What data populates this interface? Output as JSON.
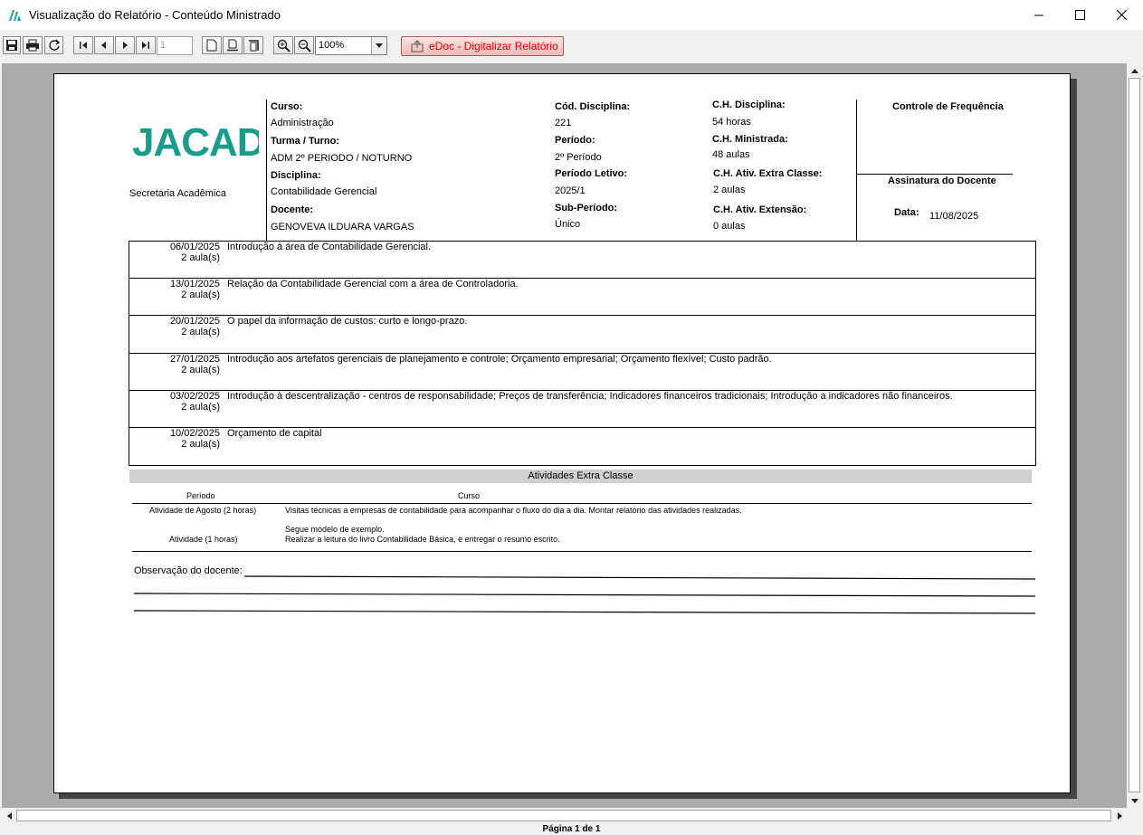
{
  "window": {
    "title": "Visualização do Relatório - Conteúdo Ministrado",
    "logo_icon": "jacad-logo-icon",
    "controls": [
      "minimize-icon",
      "maximize-icon",
      "close-icon"
    ]
  },
  "toolbar": {
    "page_value": "1",
    "zoom_value": "100%",
    "edoc_label": "eDoc - Digitalizar Relatório",
    "icons": [
      "save-icon",
      "print-icon",
      "refresh-icon",
      "first-page-icon",
      "prev-page-icon",
      "next-page-icon",
      "last-page-icon",
      "single-page-icon",
      "page-width-icon",
      "full-page-icon",
      "zoom-in-icon",
      "zoom-out-icon",
      "edoc-upload-icon"
    ]
  },
  "report": {
    "logo_text": "JACAD",
    "secretaria": "Secretaria Acadêmica",
    "curso_label": "Curso:",
    "curso": "Administração",
    "turma_label": "Turma / Turno:",
    "turma": "ADM 2º PERIODO / NOTURNO",
    "disciplina_label": "Disciplina:",
    "disciplina": "Contabilidade Gerencial",
    "docente_label": "Docente:",
    "docente": "GENOVEVA ILDUARA VARGAS",
    "cod_label": "Cód. Disciplina:",
    "cod": "221",
    "periodo_label": "Período:",
    "periodo": "2º Período",
    "periodo_letivo_label": "Período Letivo:",
    "periodo_letivo": "2025/1",
    "sub_periodo_label": "Sub-Período:",
    "sub_periodo": "Único",
    "ch_disciplina_label": "C.H. Disciplina:",
    "ch_disciplina": "54 horas",
    "ch_ministrada_label": "C.H. Ministrada:",
    "ch_ministrada": "48 aulas",
    "ch_extra_label": "C.H. Ativ. Extra Classe:",
    "ch_extra": "2 aulas",
    "ch_extensao_label": "C.H. Ativ. Extensão:",
    "ch_extensao": "0 aulas",
    "controle_label": "Controle de Frequência",
    "assinatura_label": "Assinatura do Docente",
    "data_label": "Data:",
    "data": "11/08/2025",
    "aulas": [
      {
        "date": "06/01/2025",
        "count": "2 aula(s)",
        "topic": "Introdução à área de Contabilidade Gerencial."
      },
      {
        "date": "13/01/2025",
        "count": "2 aula(s)",
        "topic": "Relação da Contabilidade Gerencial com a área de Controladoria."
      },
      {
        "date": "20/01/2025",
        "count": "2 aula(s)",
        "topic": "O papel da informação de custos: curto e longo-prazo."
      },
      {
        "date": "27/01/2025",
        "count": "2 aula(s)",
        "topic": "Introdução aos artefatos gerenciais de planejamento e controle; Orçamento empresarial; Orçamento flexível; Custo padrão."
      },
      {
        "date": "03/02/2025",
        "count": "2 aula(s)",
        "topic": "Introdução à descentralização - centros de responsabilidade; Preços de transferência; Indicadores financeiros tradicionais; Introdução a indicadores não financeiros."
      },
      {
        "date": "10/02/2025",
        "count": "2 aula(s)",
        "topic": "Orçamento de capital"
      }
    ],
    "extra_title": "Atividades Extra Classe",
    "extra_header_periodo": "Período",
    "extra_header_curso": "Curso",
    "extra_rows": [
      {
        "periodo": "Atividade de Agosto (2 horas)",
        "curso": "Visitas técnicas a empresas de contabilidade para acompanhar o fluxo do dia a dia. Montar relatório das atividades realizadas."
      },
      {
        "periodo": "",
        "curso": "Segue modelo de exemplo."
      },
      {
        "periodo": "Atividade (1 horas)",
        "curso": "Realizar a leitura do livro Contabilidade Básica, e entregar o resumo escrito."
      }
    ],
    "observacao_label": "Observação do docente:"
  },
  "status": {
    "page_info": "Página 1 de 1"
  }
}
